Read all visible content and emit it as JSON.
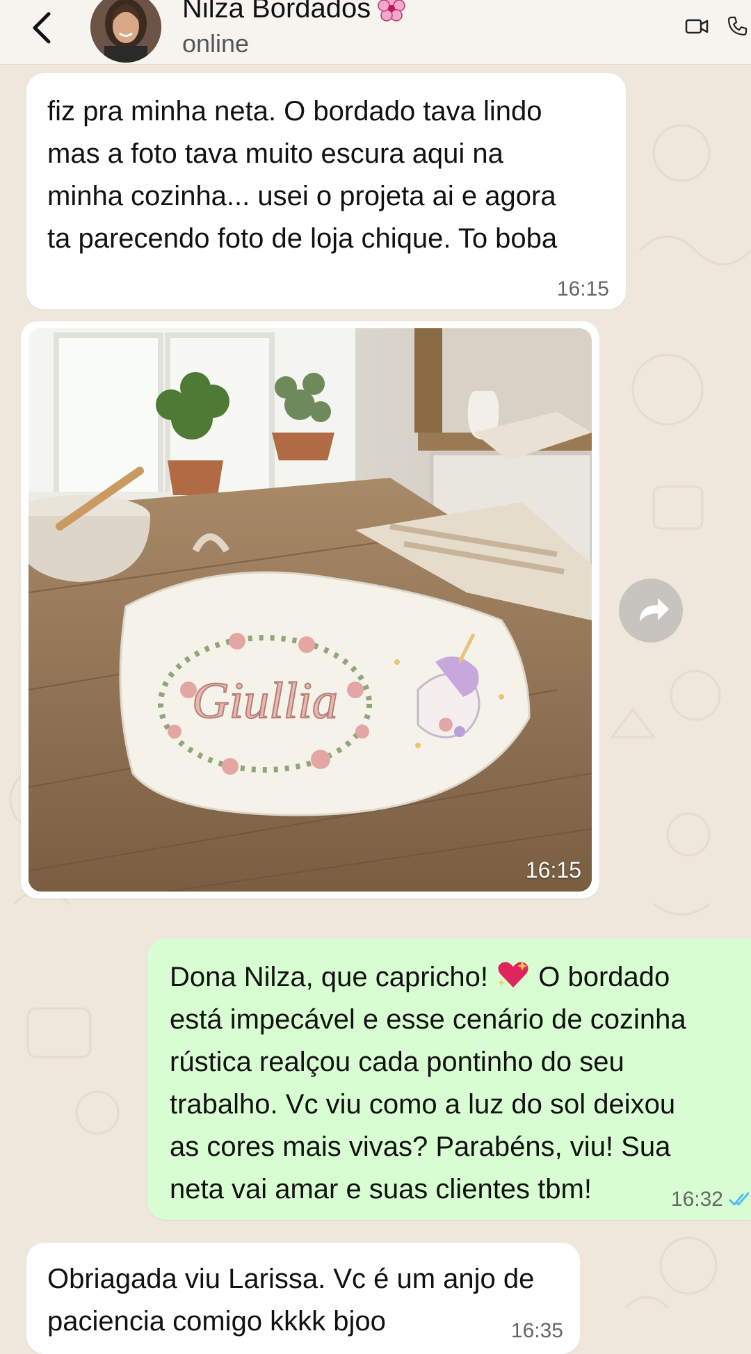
{
  "header": {
    "contact_name": "Nilza Bordados",
    "status": "online"
  },
  "messages": [
    {
      "direction": "incoming",
      "text": "fiz pra minha neta. O bordado tava lindo\nmas a foto tava muito escura aqui na\nminha cozinha... usei o projeta ai e agora\nta parecendo foto de loja chique. To boba",
      "time": "16:15"
    },
    {
      "direction": "incoming",
      "type": "image",
      "embroidered_name": "Giullia",
      "time": "16:15"
    },
    {
      "direction": "outgoing",
      "text_before_emoji": "Dona Nilza, que capricho! ",
      "text_after_emoji": " O bordado\nestá impecável e esse cenário de cozinha\nrústica realçou cada pontinho do seu\ntrabalho. Vc viu como a luz do sol deixou\nas cores mais vivas? Parabéns, viu! Sua\nneta vai amar e suas clientes tbm!",
      "time": "16:32",
      "status": "read"
    },
    {
      "direction": "incoming",
      "text": "Obriagada viu Larissa. Vc é um anjo de\npaciencia comigo kkkk bjoo",
      "time": "16:35"
    }
  ],
  "icons": [
    "back-icon",
    "flower-emoji-icon",
    "video-call-icon",
    "voice-call-icon",
    "forward-icon",
    "sparkling-heart-emoji-icon",
    "double-check-icon"
  ],
  "colors": {
    "wallpaper": "#efe7dc",
    "incoming_bubble": "#ffffff",
    "outgoing_bubble": "#d9fdd3",
    "read_ticks": "#53bdeb"
  }
}
